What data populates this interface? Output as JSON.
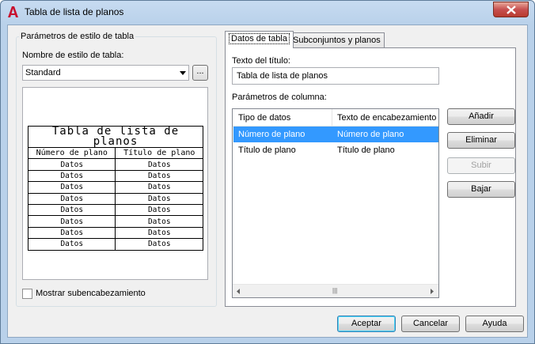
{
  "window": {
    "title": "Tabla de lista de planos"
  },
  "left_panel": {
    "group_title": "Parámetros de estilo de tabla",
    "style_name_label": "Nombre de estilo de tabla:",
    "style_name_value": "Standard",
    "browse_label": "...",
    "preview": {
      "title": "Tabla de lista de planos",
      "headers": [
        "Número de plano",
        "Título de plano"
      ],
      "rows": [
        [
          "Datos",
          "Datos"
        ],
        [
          "Datos",
          "Datos"
        ],
        [
          "Datos",
          "Datos"
        ],
        [
          "Datos",
          "Datos"
        ],
        [
          "Datos",
          "Datos"
        ],
        [
          "Datos",
          "Datos"
        ],
        [
          "Datos",
          "Datos"
        ],
        [
          "Datos",
          "Datos"
        ]
      ]
    },
    "show_subheader_label": "Mostrar subencabezamiento",
    "show_subheader_checked": false
  },
  "tabs": [
    {
      "label": "Datos de tabla",
      "active": true
    },
    {
      "label": "Subconjuntos y planos",
      "active": false
    }
  ],
  "table_data_tab": {
    "title_text_label": "Texto del título:",
    "title_text_value": "Tabla de lista de planos",
    "column_params_label": "Parámetros de columna:",
    "columns_header": [
      "Tipo de datos",
      "Texto de encabezamiento"
    ],
    "rows": [
      {
        "type": "Número de plano",
        "heading": "Número de plano",
        "selected": true
      },
      {
        "type": "Título de plano",
        "heading": "Título de plano",
        "selected": false
      }
    ],
    "buttons": {
      "add": "Añadir",
      "remove": "Eliminar",
      "up": "Subir",
      "down": "Bajar"
    }
  },
  "footer": {
    "ok": "Aceptar",
    "cancel": "Cancelar",
    "help": "Ayuda"
  },
  "colors": {
    "selection": "#3399ff",
    "app_icon_red": "#c8102e"
  }
}
